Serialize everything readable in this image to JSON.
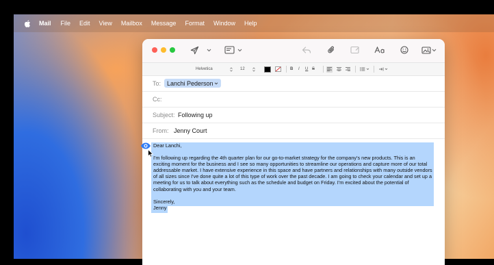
{
  "menubar": {
    "app": "Mail",
    "items": [
      "File",
      "Edit",
      "View",
      "Mailbox",
      "Message",
      "Format",
      "Window",
      "Help"
    ]
  },
  "format_bar": {
    "font": "Helvetica",
    "size": "12",
    "bold": "B",
    "italic": "I",
    "underline": "U",
    "strike": "S"
  },
  "compose": {
    "to_label": "To:",
    "to_recipient": "Lanchi Pederson",
    "cc_label": "Cc:",
    "subject_label": "Subject:",
    "subject_value": "Following up",
    "from_label": "From:",
    "from_value": "Jenny Court"
  },
  "message": {
    "greeting": "Dear Lanchi,",
    "paragraph": "I'm following up regarding the 4th quarter plan for our go-to-market strategy for the company's new products. This is an exciting moment for the business and I see so many opportunities to streamline our operations and capture more of our total addressable market. I have extensive experience in this space and have partners and relationships with many outside vendors of all sizes since I've done quite a lot of this type of work over the past decade. I am going to check your calendar and set up a meeting for us to talk about everything such as the schedule and budget on Friday. I'm excited about the potential of collaborating with you and your team.",
    "closing": "Sincerely,",
    "signature": "Jenny"
  },
  "colors": {
    "selection": "#b4d6fd",
    "recipient_token": "#c7dcf8",
    "close": "#fe5f57",
    "minimize": "#febc2e",
    "zoom": "#28c840"
  },
  "icons": [
    "apple-icon",
    "send-icon",
    "header-fields-icon",
    "reply-icon",
    "attachment-icon",
    "markup-icon",
    "format-icon",
    "emoji-icon",
    "photo-browser-icon",
    "writing-tools-icon",
    "pointer-cursor-icon"
  ]
}
